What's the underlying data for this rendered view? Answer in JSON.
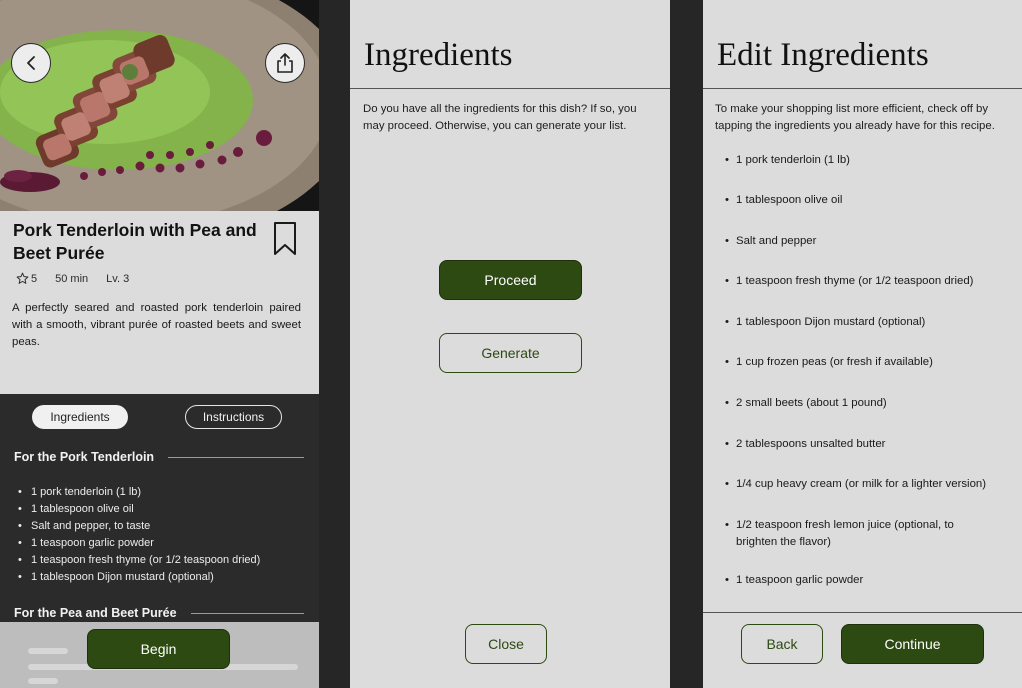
{
  "recipe": {
    "title": "Pork Tenderloin with Pea and Beet Purée",
    "rating": "5",
    "time": "50 min",
    "level": "Lv. 3",
    "description": "A perfectly seared and roasted pork tenderloin paired with a smooth, vibrant purée of roasted beets and sweet peas.",
    "tabs": {
      "ingredients": "Ingredients",
      "instructions": "Instructions"
    },
    "section1": "For the Pork Tenderloin",
    "section1_items": [
      "1 pork tenderloin (1 lb)",
      "1 tablespoon olive oil",
      "Salt and pepper, to taste",
      "1 teaspoon garlic powder",
      "1 teaspoon fresh thyme (or 1/2 teaspoon dried)",
      "1 tablespoon Dijon mustard (optional)"
    ],
    "section2": "For the Pea and Beet Purée",
    "begin_label": "Begin"
  },
  "confirm": {
    "title": "Ingredients",
    "text": "Do you have all the ingredients for this dish? If so, you may proceed. Otherwise, you can generate your list.",
    "proceed_label": "Proceed",
    "generate_label": "Generate",
    "close_label": "Close"
  },
  "edit": {
    "title": "Edit Ingredients",
    "text": "To make your shopping list more efficient, check off by tapping the ingredients you already have for this recipe.",
    "items": [
      "1 pork tenderloin (1 lb)",
      "1 tablespoon olive oil",
      "Salt and pepper",
      "1 teaspoon fresh thyme (or 1/2 teaspoon dried)",
      "1 tablespoon Dijon mustard (optional)",
      "1 cup frozen peas (or fresh if available)",
      "2 small beets (about 1 pound)",
      "2 tablespoons unsalted butter",
      "1/4 cup heavy cream (or milk for a lighter version)",
      "1/2 teaspoon fresh lemon juice (optional, to brighten the flavor)",
      "1 teaspoon garlic powder"
    ],
    "back_label": "Back",
    "continue_label": "Continue"
  },
  "colors": {
    "accent": "#2d4a12",
    "panel": "#dcdcdc",
    "dark": "#2b2b2b"
  }
}
